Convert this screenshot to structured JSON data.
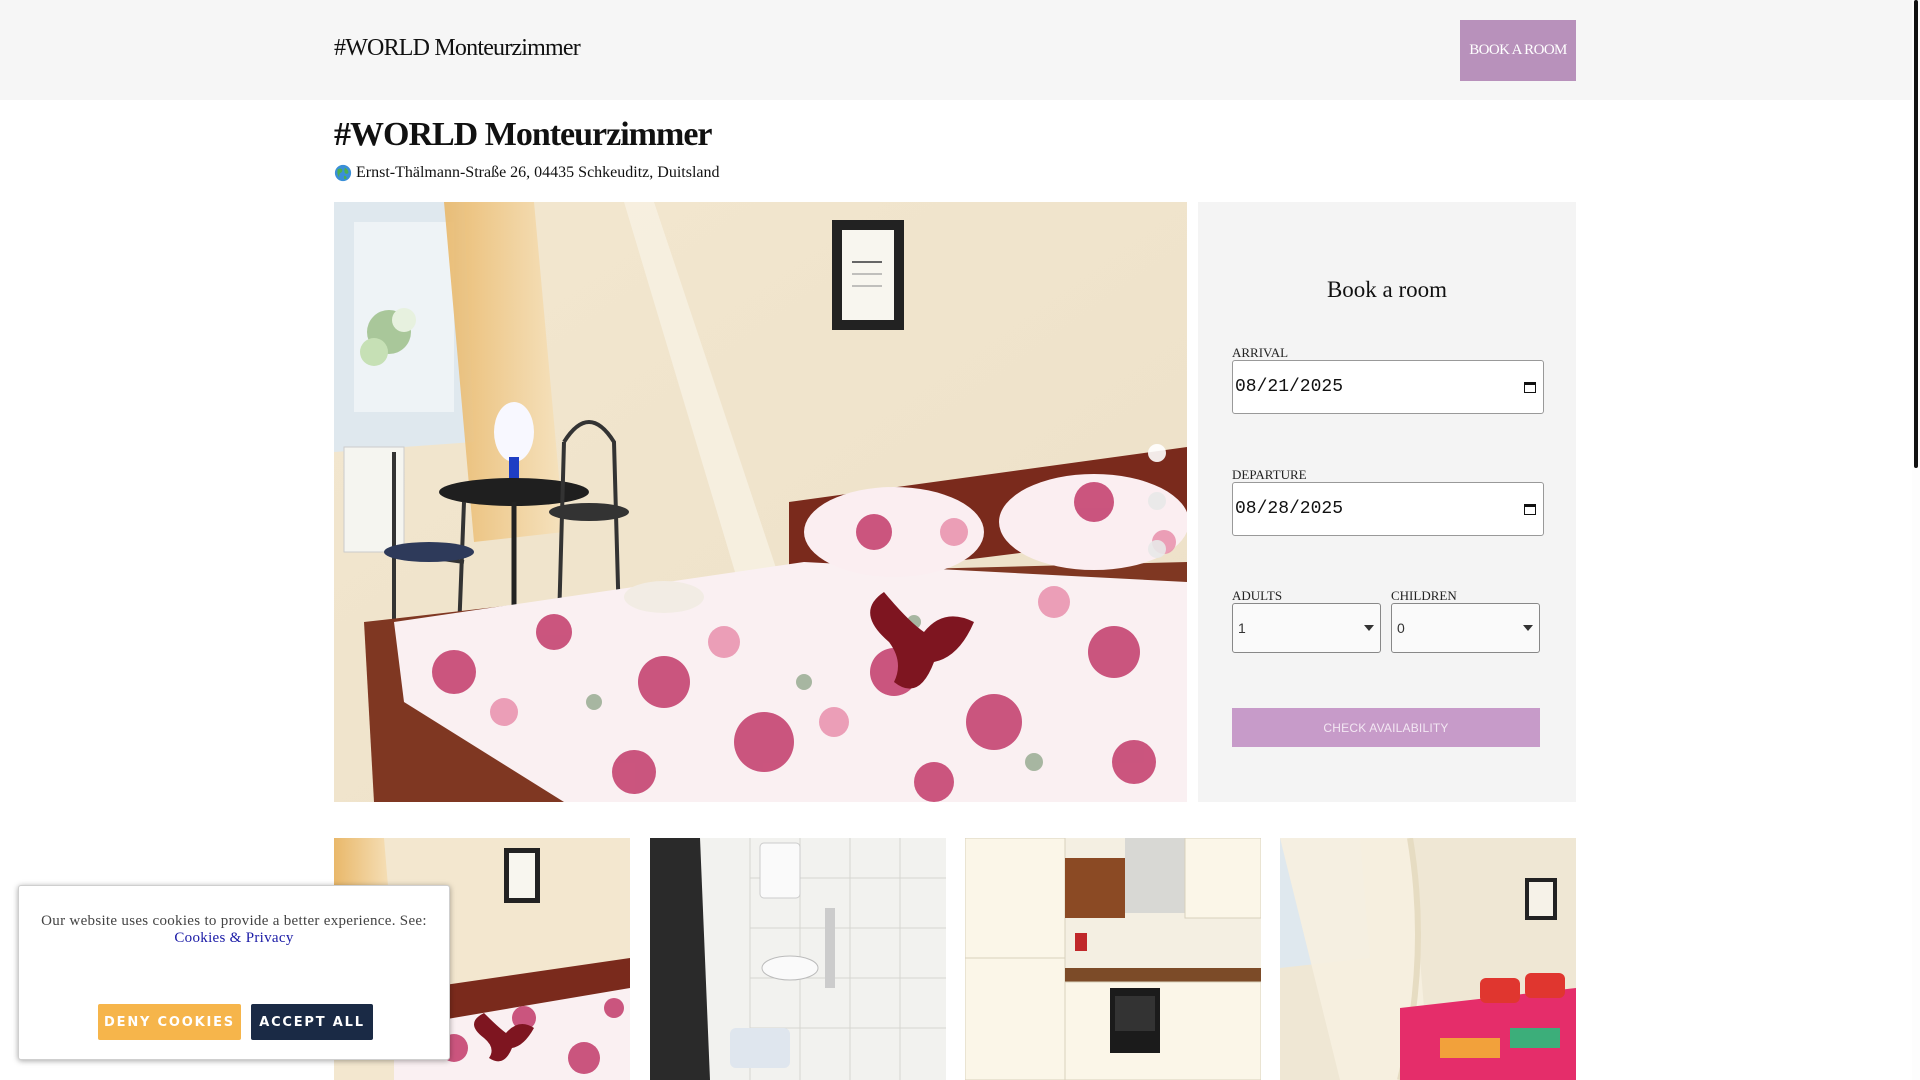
{
  "header": {
    "brand": "#WORLD Monteurzimmer",
    "book_button": "BOOK A ROOM"
  },
  "property": {
    "title": "#WORLD Monteurzimmer",
    "address_icon": "globe-icon",
    "address": "Ernst-Thälmann-Straße 26, 04435 Schkeuditz, Duitsland"
  },
  "gallery": {
    "slide_count": 3,
    "active_slide": 1
  },
  "booking": {
    "title": "Book a room",
    "arrival_label": "ARRIVAL",
    "arrival_value": "08/21/2025",
    "departure_label": "DEPARTURE",
    "departure_value": "08/28/2025",
    "adults_label": "ADULTS",
    "adults_value": "1",
    "children_label": "CHILDREN",
    "children_value": "0",
    "check_button": "CHECK AVAILABILITY"
  },
  "cookie_banner": {
    "text": "Our website uses cookies to provide a better experience. See:",
    "link": "Cookies & Privacy",
    "deny_button": "DENY COOKIES",
    "accept_button": "ACCEPT ALL"
  },
  "colors": {
    "accent": "#b891bb",
    "check_button": "#c79bc9",
    "deny": "#f6b54b",
    "accept": "#1a2a45"
  }
}
